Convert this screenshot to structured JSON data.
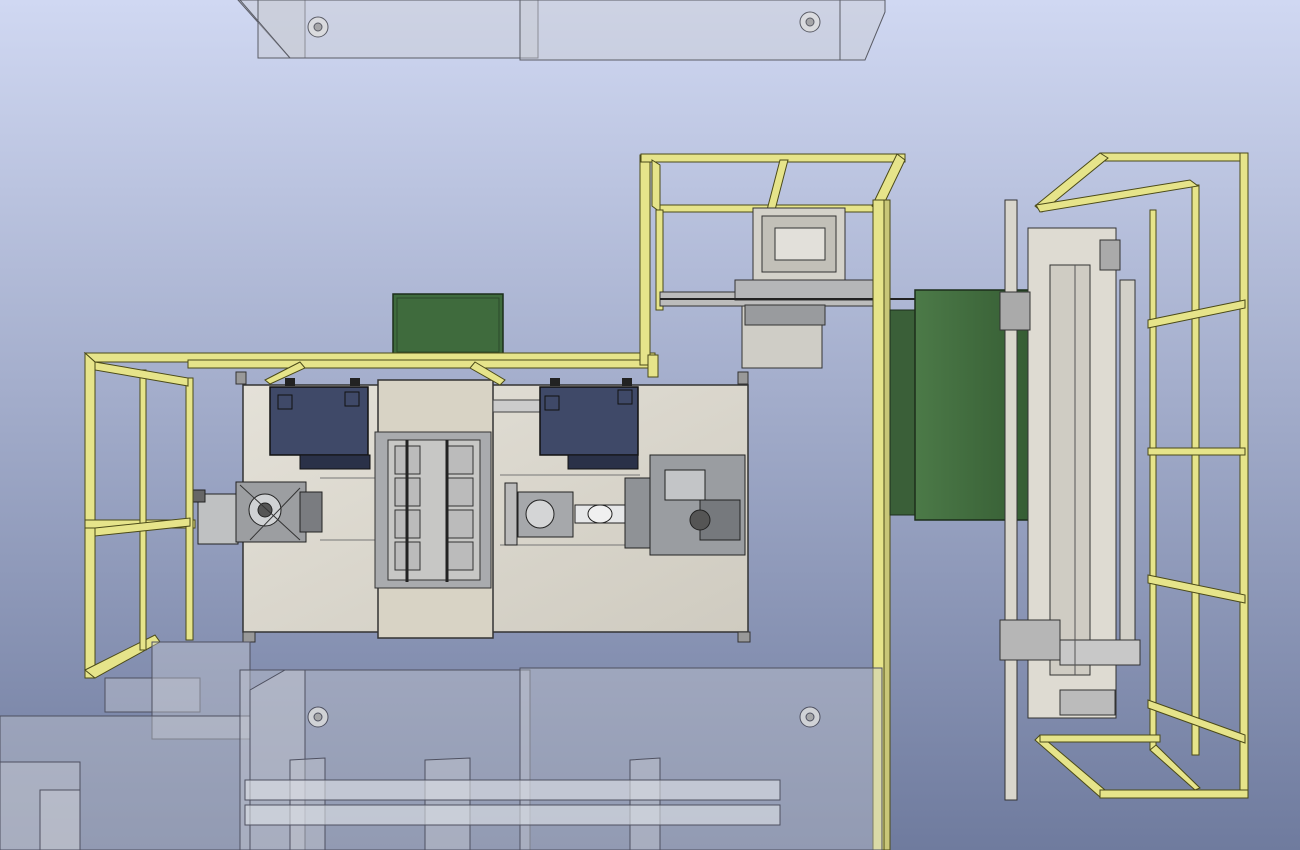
{
  "viewport": {
    "kind": "cad-3d-viewport",
    "view": "top",
    "background_top": "#d0d8f2",
    "background_bottom": "#6f7b9e"
  },
  "colors": {
    "guard_frame": "#e6e48a",
    "guard_frame_edge": "#4b4a18",
    "platform": "#dedad0",
    "controller_cabinet": "#3f4968",
    "green_panel": "#3f6b3d",
    "ghost_equipment": "#c9cbd3",
    "machinery": "#8a8d92"
  },
  "scene": {
    "objects": [
      {
        "name": "top-transparent-fixture",
        "type": "transparent-housing"
      },
      {
        "name": "left-safety-frame",
        "type": "yellow-guard-frame"
      },
      {
        "name": "robot-cell-platform",
        "type": "base-plate"
      },
      {
        "name": "left-controller-cabinet",
        "type": "controller"
      },
      {
        "name": "right-controller-cabinet",
        "type": "controller"
      },
      {
        "name": "green-top-box",
        "type": "enclosure"
      },
      {
        "name": "center-pedestal",
        "type": "pedestal"
      },
      {
        "name": "part-fixture-tray",
        "type": "fixture"
      },
      {
        "name": "left-robot-arm",
        "type": "robot"
      },
      {
        "name": "right-robot-arm",
        "type": "robot"
      },
      {
        "name": "upper-safety-frame",
        "type": "yellow-guard-frame"
      },
      {
        "name": "feeder-unit",
        "type": "feeder"
      },
      {
        "name": "vertical-rail",
        "type": "rail"
      },
      {
        "name": "green-conveyor-panel",
        "type": "panel"
      },
      {
        "name": "right-conveyor-machine",
        "type": "conveyor"
      },
      {
        "name": "right-safety-frame",
        "type": "yellow-guard-frame"
      },
      {
        "name": "bottom-transparent-fixtures",
        "type": "transparent-housing"
      }
    ]
  }
}
